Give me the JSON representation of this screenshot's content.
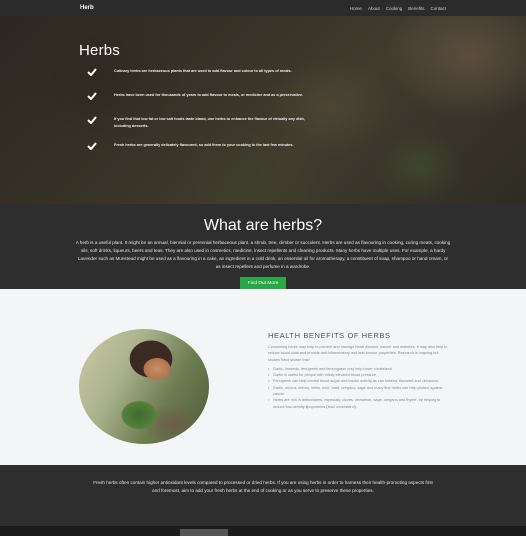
{
  "navbar": {
    "brand": "Herb",
    "links": [
      "Home",
      "About",
      "Cooking",
      "Benefits",
      "Contact"
    ]
  },
  "hero": {
    "title": "Herbs",
    "items": [
      "Culinary herbs are herbaceous plants that are used to add flavour and colour to all types of meals.",
      "Herbs have been used for thousands of years to add flavour to meals, or medicine and as a preservative.",
      "If you find that low fat or low salt foods taste bland, use herbs to enhance the flavour of virtually any dish, including desserts.",
      "Fresh herbs are generally delicately flavoured, so add them to your cooking in the last few minutes."
    ]
  },
  "what": {
    "title": "What are herbs?",
    "text": "A herb is a useful plant. It might be an annual, biennial or perennial herbaceous plant, a shrub, tree, climber or succulent. Herbs are used as flavouring in cooking, curing meats, cooking oils, soft drinks, liqueurs, beers and teas. They are also used in cosmetics, medicine, insect repellents and cleaning products. Many herbs have multiple uses. For example, a hardy Lavender such as Munstead might be used as a flavouring in a cake, an ingredient in a cold drink, an essential oil for aromatherapy, a constituent of soap, shampoo or hand cream, or as insect repellent and perfume in a wardrobe.",
    "button": "Find Out More"
  },
  "health": {
    "title": "HEALTH BENEFITS OF HERBS",
    "intro": "Consuming herbs may help to prevent and manage heart disease, cancer and diabetes. It may also help to reduce blood clots and provide anti-inflammatory and anti-tumour properties. Research is ongoing but studies have shown that:",
    "items": [
      "Garlic, linseeds, fenugreek and lemongrass may help lower cholesterol",
      "Garlic is useful for people with mildly elevated blood pressure",
      "Fenugreek can help control blood sugar and insulin activity as can linseed, flaxseed and cinnamon",
      "Garlic, onions, chives, leeks, mint, basil, oregano, sage and many fine herbs can help protect against cancer",
      "Herbs are rich in antioxidants, especially cloves, cinnamon, sage, oregano and thyme, by helping to reduce low-density lipoproteins ('bad' cholesterol)."
    ]
  },
  "closing": {
    "text": "Fresh herbs often contain higher antioxidant levels compared to processed or dried herbs. If you are using herbs in order to harness their health-promoting aspects first and foremost, aim to add your fresh herbs at the end of cooking or as you serve to preserve these properties."
  }
}
